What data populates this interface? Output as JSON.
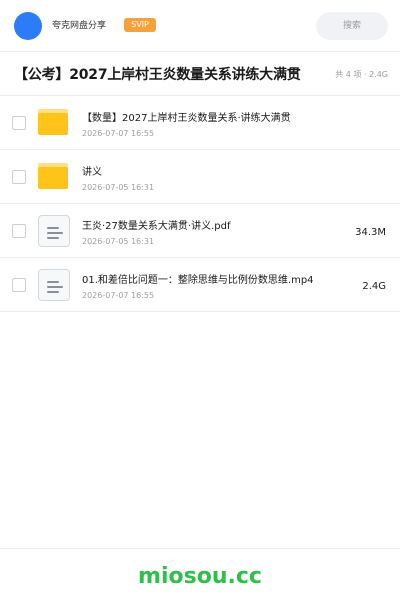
{
  "header": {
    "brand": "夸克网盘分享",
    "badge": "SVIP",
    "search_label": "搜索",
    "accent_color": "#2b7cf6"
  },
  "folder": {
    "title": "【公考】2027上岸村王炎数量关系讲练大满贯",
    "meta": "共 4 项 · 2.4G"
  },
  "files": [
    {
      "icon": "folder-icon",
      "name": "【数量】2027上岸村王炎数量关系·讲练大满贯",
      "date": "2026-07-07 16:55",
      "size": ""
    },
    {
      "icon": "folder-icon",
      "name": "讲义",
      "date": "2026-07-05 16:31",
      "size": ""
    },
    {
      "icon": "document-icon",
      "name": "王炎·27数量关系大满贯·讲义.pdf",
      "date": "2026-07-05 16:31",
      "size": "34.3M"
    },
    {
      "icon": "document-icon",
      "name": "01.和差倍比问题一：整除思维与比例份数思维.mp4",
      "date": "2026-07-07 16:55",
      "size": "2.4G"
    }
  ],
  "footer": {
    "watermark": "miosou.cc",
    "watermark_color": "#2fbf4a"
  }
}
